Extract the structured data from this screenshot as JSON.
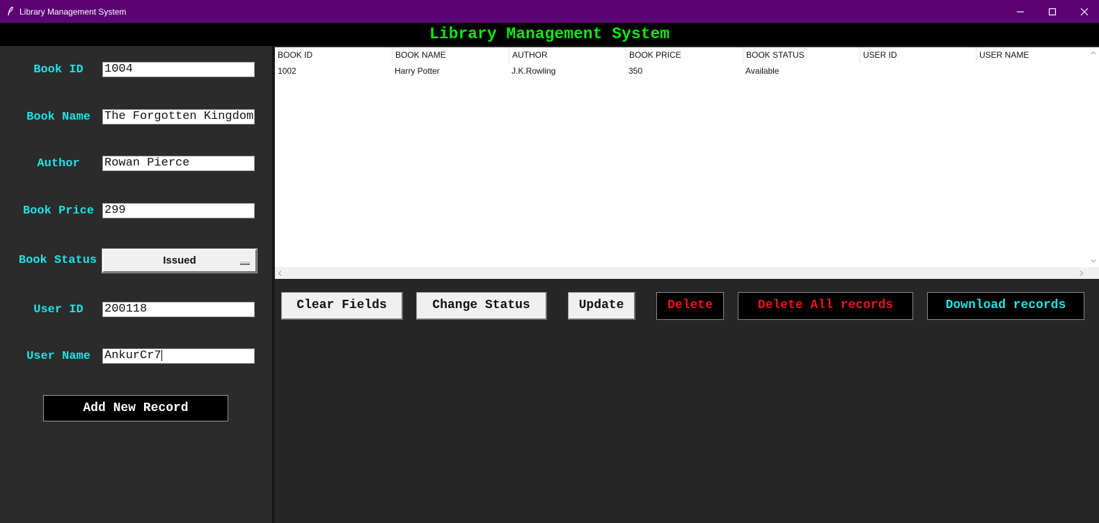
{
  "window": {
    "title": "Library Management System"
  },
  "heading": "Library Management System",
  "form": {
    "book_id": {
      "label": "Book ID",
      "value": "1004"
    },
    "book_name": {
      "label": "Book Name",
      "value": "The Forgotten Kingdom"
    },
    "author": {
      "label": "Author",
      "value": "Rowan Pierce"
    },
    "book_price": {
      "label": "Book Price",
      "value": "299"
    },
    "book_status": {
      "label": "Book Status",
      "value": "Issued"
    },
    "user_id": {
      "label": "User ID",
      "value": "200118"
    },
    "user_name": {
      "label": "User Name",
      "value": "AnkurCr7"
    },
    "add_button": "Add New Record"
  },
  "table": {
    "columns": [
      "BOOK ID",
      "BOOK NAME",
      "AUTHOR",
      "BOOK PRICE",
      "BOOK STATUS",
      "USER ID",
      "USER NAME"
    ],
    "rows": [
      [
        "1002",
        "Harry Potter",
        "J.K.Rowling",
        "350",
        "Available",
        "",
        ""
      ]
    ]
  },
  "actions": {
    "clear": "Clear Fields",
    "change_status": "Change Status",
    "update": "Update",
    "delete": "Delete",
    "delete_all": "Delete All records",
    "download": "Download records"
  },
  "colors": {
    "titlebar": "#5c0374",
    "heading_text": "#0fe70f",
    "label_text": "#1fe2e6",
    "danger_text": "#e8141b",
    "download_text": "#1fe2e6"
  }
}
